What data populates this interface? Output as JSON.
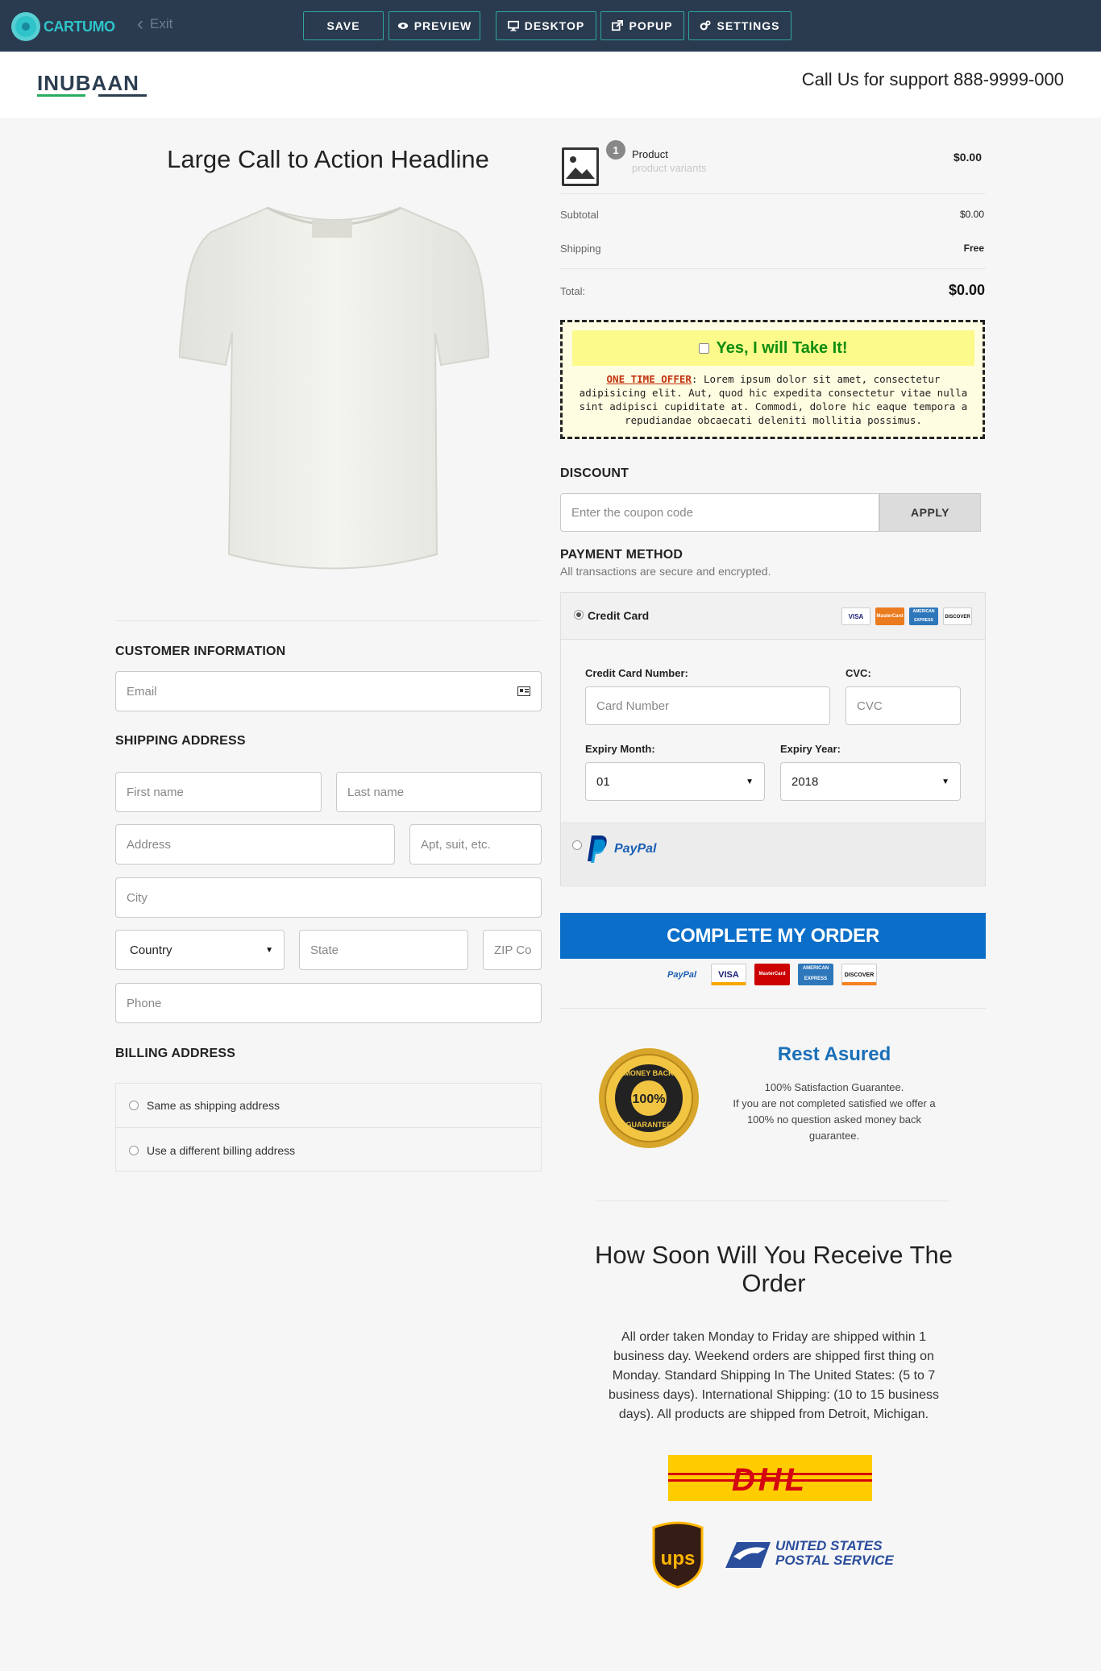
{
  "editor": {
    "brand": "CARTUMO",
    "exit_label": "Exit",
    "buttons": {
      "save": "SAVE",
      "preview": "PREVIEW",
      "desktop": "DESKTOP",
      "popup": "POPUP",
      "settings": "SETTINGS"
    },
    "accent_color": "#2fa79b",
    "bar_color": "#2a3a4f"
  },
  "store": {
    "logo_text": "INUBAAN",
    "support_text": "Call Us for support 888-9999-000"
  },
  "left": {
    "headline": "Large Call to Action Headline",
    "product_image": "white-tshirt",
    "customer_info_title": "CUSTOMER INFORMATION",
    "email_placeholder": "Email",
    "shipping_title": "SHIPPING ADDRESS",
    "first_name_placeholder": "First name",
    "last_name_placeholder": "Last name",
    "address_placeholder": "Address",
    "apt_placeholder": "Apt, suit, etc.",
    "city_placeholder": "City",
    "country_value": "Country",
    "state_placeholder": "State",
    "zip_placeholder": "ZIP Co",
    "phone_placeholder": "Phone",
    "billing_title": "BILLING ADDRESS",
    "billing_options": [
      "Same as shipping address",
      "Use a different billing address"
    ]
  },
  "summary": {
    "product_count": "1",
    "product_name": "Product",
    "product_variants": "product variants",
    "product_price": "$0.00",
    "subtotal_label": "Subtotal",
    "subtotal_value": "$0.00",
    "shipping_label": "Shipping",
    "shipping_value": "Free",
    "total_label": "Total:",
    "total_value": "$0.00"
  },
  "upsell": {
    "title": "Yes, I will Take It!",
    "offer_label": "ONE TIME OFFER",
    "offer_text": ": Lorem ipsum dolor sit amet, consectetur adipisicing elit. Aut, quod hic expedita consectetur vitae nulla sint adipisci cupiditate at. Commodi, dolore hic eaque tempora a repudiandae obcaecati deleniti mollitia possimus."
  },
  "discount": {
    "title": "DISCOUNT",
    "placeholder": "Enter the coupon code",
    "apply_label": "APPLY"
  },
  "payment": {
    "title": "PAYMENT METHOD",
    "subtitle": "All transactions are secure and encrypted.",
    "credit_card_label": "Credit Card",
    "card_number_label": "Credit Card Number:",
    "card_number_placeholder": "Card Number",
    "cvc_label": "CVC:",
    "cvc_placeholder": "CVC",
    "expiry_month_label": "Expiry Month:",
    "expiry_month_value": "01",
    "expiry_year_label": "Expiry Year:",
    "expiry_year_value": "2018",
    "paypal_label": "PayPal",
    "cards": [
      "VISA",
      "MasterCard",
      "AMERICAN EXPRESS",
      "DISCOVER"
    ]
  },
  "cta": {
    "label": "COMPLETE MY ORDER",
    "color": "#0b6fc9"
  },
  "guarantee": {
    "seal_text": "MONEY BACK 100% GUARANTEE",
    "title": "Rest Asured",
    "line1": "100% Satisfaction Guarantee.",
    "line2": "If you are not completed satisfied we offer a 100%  no question asked money back guarantee."
  },
  "delivery": {
    "title": "How Soon Will You Receive The Order",
    "text": "All order taken Monday to Friday are shipped within 1 business day. Weekend orders are shipped first thing on Monday. Standard Shipping In The United States: (5 to 7 business days). International Shipping: (10 to 15 business days). All products are shipped from Detroit, Michigan.",
    "carriers": {
      "dhl": "DHL",
      "ups": "ups",
      "usps_line1": "UNITED STATES",
      "usps_line2": "POSTAL SERVICE"
    }
  }
}
